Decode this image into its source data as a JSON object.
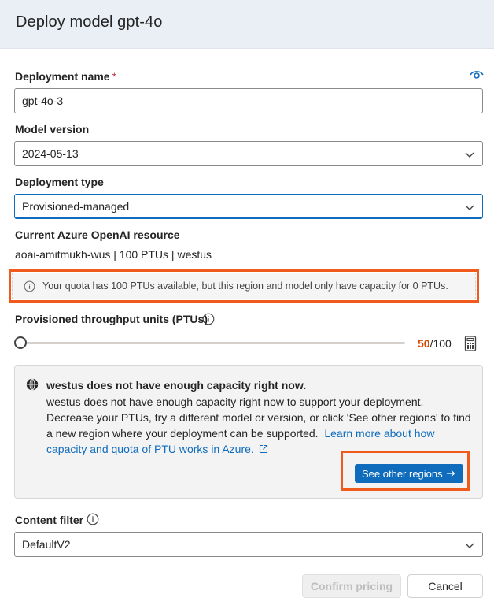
{
  "dialog": {
    "title": "Deploy model gpt-4o"
  },
  "deployment_name": {
    "label": "Deployment name",
    "required_mark": "*",
    "value": "gpt-4o-3"
  },
  "model_version": {
    "label": "Model version",
    "value": "2024-05-13"
  },
  "deployment_type": {
    "label": "Deployment type",
    "value": "Provisioned-managed"
  },
  "resource": {
    "label": "Current Azure OpenAI resource",
    "value": "aoai-amitmukh-wus | 100 PTUs | westus"
  },
  "quota_notice": {
    "text": "Your quota has 100 PTUs available, but this region and model only have capacity for 0 PTUs."
  },
  "ptu": {
    "label": "Provisioned throughput units (PTUs)",
    "current": "50",
    "max": "/100",
    "slider_fraction": 0.0
  },
  "capacity_warning": {
    "title": "westus does not have enough capacity right now.",
    "body": "westus does not have enough capacity right now to support your deployment. Decrease your PTUs, try a different model or version, or click 'See other regions' to find a new region where your deployment can be supported.",
    "link_text": "Learn more about how capacity and quota of PTU works in Azure.",
    "button_label": "See other regions"
  },
  "content_filter": {
    "label": "Content filter",
    "value": "DefaultV2"
  },
  "footer": {
    "confirm_label": "Confirm pricing",
    "cancel_label": "Cancel"
  },
  "colors": {
    "accent": "#0f6cbd",
    "highlight": "#f05a1a",
    "ptu_current": "#d74600"
  },
  "icons": [
    "eye-icon",
    "info-icon",
    "calculator-icon",
    "globe-icon",
    "external-link-icon",
    "arrow-right-icon",
    "chevron-down-icon"
  ]
}
